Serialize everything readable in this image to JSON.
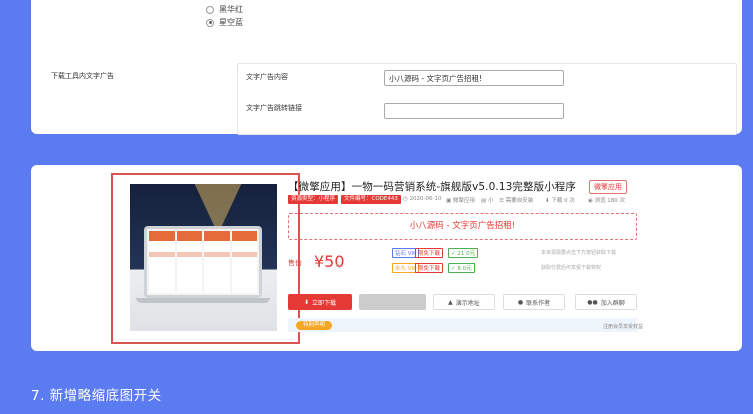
{
  "settings": {
    "radio_option_1": "黑华红",
    "radio_option_2": "星空蓝",
    "section_label": "下载工具内文字广告",
    "ad_text_label": "文字广告内容",
    "ad_text_value": "小八源码 - 文字页广告招租!",
    "ad_link_label": "文字广告跳转链接",
    "ad_link_value": ""
  },
  "product": {
    "title": "【微擎应用】一物一码营销系统-旗舰版v5.0.13完整版小程序",
    "badge": "微擎应用",
    "tag_type": "资源类型：小程序",
    "tag_code": "文件编号：CODE443",
    "meta_date": "2020-06-10",
    "meta_type": "微擎应用",
    "meta_size": "小",
    "meta_install": "需要自安装",
    "meta_views": "下载 0 次",
    "meta_browse": "浏览 180 次",
    "ad_text": "小八源码 - 文字页广告招租!",
    "price_label": "售价",
    "price": "¥50",
    "price_unit": "元",
    "vip1": "钻石 VIP",
    "vip1_free": "限免下载",
    "vip1_price": "21.0元",
    "vip2": "永久 VIP",
    "vip2_free": "限免下载",
    "vip2_price": "8.0元",
    "note1": "本资源需要点击下方按钮获取下载",
    "note2": "获取付费后可享受下载特权",
    "btn_download": "立即下载",
    "btn_demo": "演示地址",
    "btn_author": "联系作者",
    "btn_group": "加入群聊",
    "bottom_tag": "特别声明",
    "bottom_note": "注册会员享受权益"
  },
  "heading": "7. 新增略缩底图开关",
  "colors": {
    "page_bg": "#5b7cf0",
    "accent_red": "#e53935",
    "highlight_border": "#d9534f"
  }
}
